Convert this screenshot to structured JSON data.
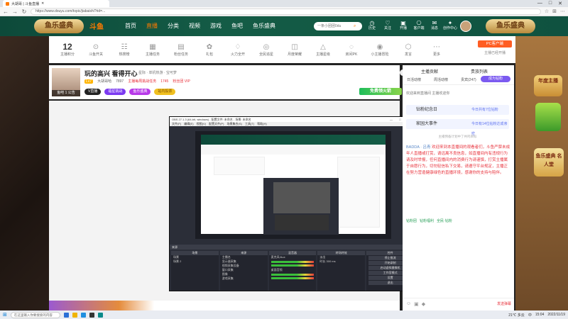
{
  "browser": {
    "tab_title": "大胡哥 | 斗鱼直播",
    "url": "https://www.douyu.com/topic/jiabaishi?rid=...",
    "window_controls": [
      "—",
      "□",
      "✕"
    ]
  },
  "header": {
    "logo_left": "鱼乐盛典",
    "brand": "斗鱼",
    "nav": [
      "首页",
      "直播",
      "分类",
      "视频",
      "游戏",
      "鱼吧",
      "鱼乐盛典"
    ],
    "active_nav": "直播",
    "search_placeholder": "一条小团团0du",
    "icons": [
      {
        "glyph": "◷",
        "label": "历史"
      },
      {
        "glyph": "♡",
        "label": "关注"
      },
      {
        "glyph": "▣",
        "label": "开播"
      },
      {
        "glyph": "⎔",
        "label": "客户端"
      },
      {
        "glyph": "✉",
        "label": "消息"
      },
      {
        "glyph": "✦",
        "label": "创作中心"
      }
    ],
    "logo_right": "鱼乐盛典"
  },
  "toolbar": {
    "items": [
      {
        "value": "12",
        "label": "主播积分"
      },
      {
        "glyph": "⊙",
        "label": "斗鱼开关"
      },
      {
        "glyph": "☷",
        "label": "热搜榜"
      },
      {
        "glyph": "▦",
        "label": "主播任务"
      },
      {
        "glyph": "▤",
        "label": "粉丝任务"
      },
      {
        "glyph": "✿",
        "label": "礼包"
      },
      {
        "glyph": "♢",
        "label": "火力全开"
      },
      {
        "glyph": "◎",
        "label": "全民追星"
      },
      {
        "glyph": "◫",
        "label": "月度荣耀"
      },
      {
        "glyph": "△",
        "label": "主播星级"
      },
      {
        "glyph": "◌",
        "label": "房间PK"
      },
      {
        "glyph": "◉",
        "label": "小主播冒险"
      },
      {
        "glyph": "⬡",
        "label": "发言"
      },
      {
        "glyph": "⋯",
        "label": "更多"
      }
    ],
    "pc_button": "PC客户端",
    "pc_sub": "主播已经开播"
  },
  "room": {
    "title": "玩的高兴 看得开心",
    "category": "星际 · 单机热游 · 宝可梦",
    "level": "Lv7",
    "anchor_name": "大胡哥哈",
    "fans": "7897",
    "task": "主播每周挑战任务",
    "watch": "1745",
    "badge": "粉丝团 VIP",
    "notice": "鱼吧 1 公告",
    "pills": [
      "V直播",
      "福星挑战",
      "鱼乐盛典",
      "站内投票"
    ],
    "follow_count": "72841",
    "follow": "关注",
    "free_gift": "免费领火箭",
    "share": "分享",
    "report": "举报"
  },
  "obs": {
    "title": "OBS 27.1.3 (64-bit, windows) - 配置文件: 未命名 - 场景: 未命名",
    "menu": "文件(F) 编辑(E) 视图(V) 配置文件(P) 场景集合(S) 工具(T) 帮助(H)",
    "dock_bar": "来源",
    "docks": [
      {
        "header": "场景",
        "rows": [
          "场景",
          "场景 2"
        ]
      },
      {
        "header": "来源",
        "rows": [
          "主播名",
          "显示器采集",
          "视频采集设备",
          "窗口采集",
          "图像",
          "游戏采集"
        ]
      },
      {
        "header": "混音器",
        "rows": [
          "麦克风/Aux",
          "桌面音频"
        ]
      },
      {
        "header": "转场特效",
        "rows": [
          "淡出",
          "时长 300 ms"
        ]
      },
      {
        "header": "控件",
        "rows": [
          "停止推流",
          "开始录制",
          "启动虚拟摄像机",
          "工作室模式",
          "设置",
          "退出"
        ]
      }
    ]
  },
  "chat": {
    "rank_h1": "主播贡献",
    "rank_h2": "贵族列表",
    "rank_tabs": [
      "日活动榜",
      "周活动榜",
      "贵宾(247)",
      "钻粉(108)"
    ],
    "anchor_fan": "成为钻粉",
    "note": "欢迎来到直播间 主播欢迎你",
    "banner1": "钻粉纪念日",
    "banner1_sub": "今日共有7位钻粉",
    "banner2": "家园大事件",
    "banner2_sub": "今日有14位钻粉达成亲密",
    "sys": "主播预备计划中了共鸣目标",
    "name": "BADDA · 吕青",
    "msg": "欢迎来到本直播间的观看者们，斗鱼严禁未成年人直播或打赏，请远离不良信息，如直播间内有违规行为请及时举报，任何直播间内的消费行为请谨慎，打赏主播属于自愿行为，切勿轻信私下交易，请遵守平台规定，主播正在努力营造健康绿色的直播环境，感谢你的支持与陪伴。",
    "badges": [
      "钻粉团",
      "钻粉福利",
      "全民·钻粉"
    ],
    "send": "发送弹幕"
  },
  "deco": {
    "card1": "年度主播",
    "card2": "鱼乐盛典 名人堂"
  },
  "taskbar": {
    "search": "在这里输入你要搜索的内容",
    "tray": [
      "21℃ 多云",
      "中",
      "15:04",
      "2022/11/19"
    ]
  }
}
